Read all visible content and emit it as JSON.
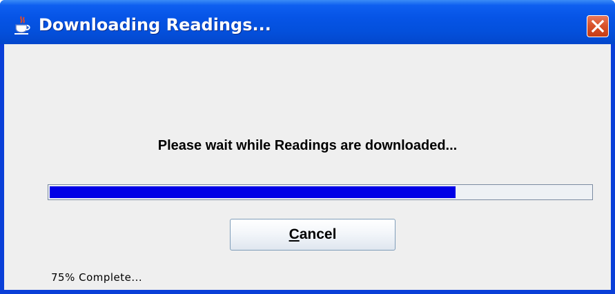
{
  "window": {
    "title": "Downloading Readings...",
    "app_icon": "java-coffee-cup-icon",
    "close_icon": "close-icon"
  },
  "dialog": {
    "message": "Please wait while Readings are downloaded...",
    "progress_percent": 75,
    "cancel_mnemonic": "C",
    "cancel_rest": "ancel",
    "status": "75% Complete..."
  },
  "colors": {
    "titlebar": "#0654e6",
    "progress_fill": "#0000e6",
    "close_button": "#d9542c",
    "dialog_background": "#efefef"
  }
}
